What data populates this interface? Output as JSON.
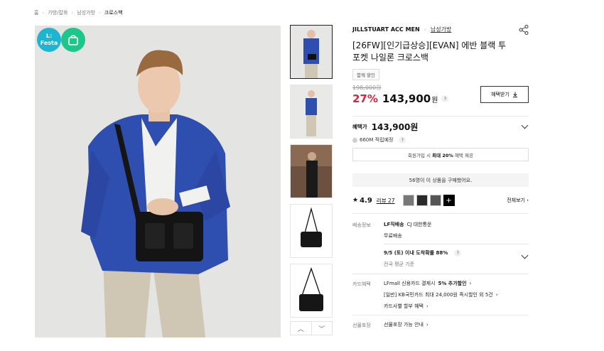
{
  "breadcrumb": [
    "홈",
    "가방/잡화",
    "남성가방",
    "크로스백"
  ],
  "badges": {
    "festa_line1": "L:",
    "festa_line2": "Festa"
  },
  "product": {
    "brand": "JILLSTUART ACC MEN",
    "category": "남성가방",
    "title": "[26FW][인기급상승][EVAN] 에반 블랙 투포켓 나일론 크로스백",
    "tag": "함께 할인",
    "original_price": "198,000원",
    "discount": "27%",
    "price": "143,900",
    "won": "원",
    "coupon_button": "혜택받기"
  },
  "benefit": {
    "label": "혜택가",
    "price": "143,900원",
    "points": "660M 적립예정",
    "member_text_prefix": "회원가입 시",
    "member_text_bold": "최대 20%",
    "member_text_suffix": "혜택 제공",
    "purchased": "56명이 이 상품을 구매했어요."
  },
  "reviews": {
    "rating": "4.9",
    "count_label": "리뷰 27",
    "view_all": "전체보기"
  },
  "shipping": {
    "label": "배송정보",
    "carrier_bold": "LF직배송",
    "carrier": "CJ 대한통운",
    "fee": "무료배송",
    "arrival": "9/5 (토) 이내 도착확률 88%",
    "arrival_sub": "전국 평균 기준"
  },
  "card": {
    "label": "카드혜택",
    "line1_prefix": "LFmall 신용카드 결제시",
    "line1_bold": "5% 추가할인",
    "line2": "[일반] KB국민카드 최대 24,000원 즉시할인 외 5건",
    "line3": "카드사별 할부 혜택"
  },
  "gift": {
    "label": "선물포장",
    "text": "선물포장 가능 안내"
  },
  "colors": {
    "accent": "#e0243d",
    "festa": "#1db5cf",
    "bag_badge": "#1fc68c"
  }
}
